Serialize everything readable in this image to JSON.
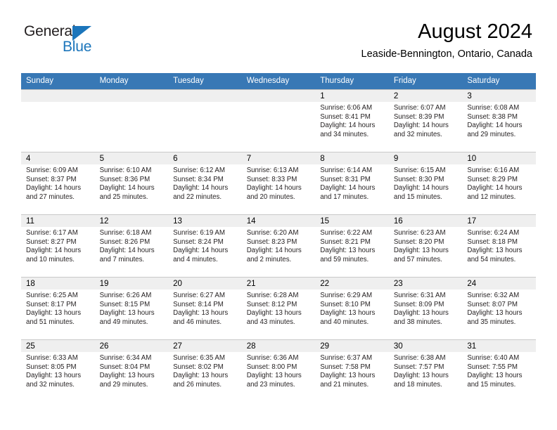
{
  "brand": {
    "word_one": "General",
    "word_two": "Blue",
    "logo_icon": "triangle-flag-icon"
  },
  "header": {
    "title": "August 2024",
    "subtitle": "Leaside-Bennington, Ontario, Canada"
  },
  "calendar": {
    "accent_color": "#3878b5",
    "daynum_bg": "#efefef",
    "weekday_headers": [
      "Sunday",
      "Monday",
      "Tuesday",
      "Wednesday",
      "Thursday",
      "Friday",
      "Saturday"
    ],
    "weeks": [
      [
        {
          "day": "",
          "sunrise": "",
          "sunset": "",
          "daylight_line1": "",
          "daylight_line2": ""
        },
        {
          "day": "",
          "sunrise": "",
          "sunset": "",
          "daylight_line1": "",
          "daylight_line2": ""
        },
        {
          "day": "",
          "sunrise": "",
          "sunset": "",
          "daylight_line1": "",
          "daylight_line2": ""
        },
        {
          "day": "",
          "sunrise": "",
          "sunset": "",
          "daylight_line1": "",
          "daylight_line2": ""
        },
        {
          "day": "1",
          "sunrise": "Sunrise: 6:06 AM",
          "sunset": "Sunset: 8:41 PM",
          "daylight_line1": "Daylight: 14 hours",
          "daylight_line2": "and 34 minutes."
        },
        {
          "day": "2",
          "sunrise": "Sunrise: 6:07 AM",
          "sunset": "Sunset: 8:39 PM",
          "daylight_line1": "Daylight: 14 hours",
          "daylight_line2": "and 32 minutes."
        },
        {
          "day": "3",
          "sunrise": "Sunrise: 6:08 AM",
          "sunset": "Sunset: 8:38 PM",
          "daylight_line1": "Daylight: 14 hours",
          "daylight_line2": "and 29 minutes."
        }
      ],
      [
        {
          "day": "4",
          "sunrise": "Sunrise: 6:09 AM",
          "sunset": "Sunset: 8:37 PM",
          "daylight_line1": "Daylight: 14 hours",
          "daylight_line2": "and 27 minutes."
        },
        {
          "day": "5",
          "sunrise": "Sunrise: 6:10 AM",
          "sunset": "Sunset: 8:36 PM",
          "daylight_line1": "Daylight: 14 hours",
          "daylight_line2": "and 25 minutes."
        },
        {
          "day": "6",
          "sunrise": "Sunrise: 6:12 AM",
          "sunset": "Sunset: 8:34 PM",
          "daylight_line1": "Daylight: 14 hours",
          "daylight_line2": "and 22 minutes."
        },
        {
          "day": "7",
          "sunrise": "Sunrise: 6:13 AM",
          "sunset": "Sunset: 8:33 PM",
          "daylight_line1": "Daylight: 14 hours",
          "daylight_line2": "and 20 minutes."
        },
        {
          "day": "8",
          "sunrise": "Sunrise: 6:14 AM",
          "sunset": "Sunset: 8:31 PM",
          "daylight_line1": "Daylight: 14 hours",
          "daylight_line2": "and 17 minutes."
        },
        {
          "day": "9",
          "sunrise": "Sunrise: 6:15 AM",
          "sunset": "Sunset: 8:30 PM",
          "daylight_line1": "Daylight: 14 hours",
          "daylight_line2": "and 15 minutes."
        },
        {
          "day": "10",
          "sunrise": "Sunrise: 6:16 AM",
          "sunset": "Sunset: 8:29 PM",
          "daylight_line1": "Daylight: 14 hours",
          "daylight_line2": "and 12 minutes."
        }
      ],
      [
        {
          "day": "11",
          "sunrise": "Sunrise: 6:17 AM",
          "sunset": "Sunset: 8:27 PM",
          "daylight_line1": "Daylight: 14 hours",
          "daylight_line2": "and 10 minutes."
        },
        {
          "day": "12",
          "sunrise": "Sunrise: 6:18 AM",
          "sunset": "Sunset: 8:26 PM",
          "daylight_line1": "Daylight: 14 hours",
          "daylight_line2": "and 7 minutes."
        },
        {
          "day": "13",
          "sunrise": "Sunrise: 6:19 AM",
          "sunset": "Sunset: 8:24 PM",
          "daylight_line1": "Daylight: 14 hours",
          "daylight_line2": "and 4 minutes."
        },
        {
          "day": "14",
          "sunrise": "Sunrise: 6:20 AM",
          "sunset": "Sunset: 8:23 PM",
          "daylight_line1": "Daylight: 14 hours",
          "daylight_line2": "and 2 minutes."
        },
        {
          "day": "15",
          "sunrise": "Sunrise: 6:22 AM",
          "sunset": "Sunset: 8:21 PM",
          "daylight_line1": "Daylight: 13 hours",
          "daylight_line2": "and 59 minutes."
        },
        {
          "day": "16",
          "sunrise": "Sunrise: 6:23 AM",
          "sunset": "Sunset: 8:20 PM",
          "daylight_line1": "Daylight: 13 hours",
          "daylight_line2": "and 57 minutes."
        },
        {
          "day": "17",
          "sunrise": "Sunrise: 6:24 AM",
          "sunset": "Sunset: 8:18 PM",
          "daylight_line1": "Daylight: 13 hours",
          "daylight_line2": "and 54 minutes."
        }
      ],
      [
        {
          "day": "18",
          "sunrise": "Sunrise: 6:25 AM",
          "sunset": "Sunset: 8:17 PM",
          "daylight_line1": "Daylight: 13 hours",
          "daylight_line2": "and 51 minutes."
        },
        {
          "day": "19",
          "sunrise": "Sunrise: 6:26 AM",
          "sunset": "Sunset: 8:15 PM",
          "daylight_line1": "Daylight: 13 hours",
          "daylight_line2": "and 49 minutes."
        },
        {
          "day": "20",
          "sunrise": "Sunrise: 6:27 AM",
          "sunset": "Sunset: 8:14 PM",
          "daylight_line1": "Daylight: 13 hours",
          "daylight_line2": "and 46 minutes."
        },
        {
          "day": "21",
          "sunrise": "Sunrise: 6:28 AM",
          "sunset": "Sunset: 8:12 PM",
          "daylight_line1": "Daylight: 13 hours",
          "daylight_line2": "and 43 minutes."
        },
        {
          "day": "22",
          "sunrise": "Sunrise: 6:29 AM",
          "sunset": "Sunset: 8:10 PM",
          "daylight_line1": "Daylight: 13 hours",
          "daylight_line2": "and 40 minutes."
        },
        {
          "day": "23",
          "sunrise": "Sunrise: 6:31 AM",
          "sunset": "Sunset: 8:09 PM",
          "daylight_line1": "Daylight: 13 hours",
          "daylight_line2": "and 38 minutes."
        },
        {
          "day": "24",
          "sunrise": "Sunrise: 6:32 AM",
          "sunset": "Sunset: 8:07 PM",
          "daylight_line1": "Daylight: 13 hours",
          "daylight_line2": "and 35 minutes."
        }
      ],
      [
        {
          "day": "25",
          "sunrise": "Sunrise: 6:33 AM",
          "sunset": "Sunset: 8:05 PM",
          "daylight_line1": "Daylight: 13 hours",
          "daylight_line2": "and 32 minutes."
        },
        {
          "day": "26",
          "sunrise": "Sunrise: 6:34 AM",
          "sunset": "Sunset: 8:04 PM",
          "daylight_line1": "Daylight: 13 hours",
          "daylight_line2": "and 29 minutes."
        },
        {
          "day": "27",
          "sunrise": "Sunrise: 6:35 AM",
          "sunset": "Sunset: 8:02 PM",
          "daylight_line1": "Daylight: 13 hours",
          "daylight_line2": "and 26 minutes."
        },
        {
          "day": "28",
          "sunrise": "Sunrise: 6:36 AM",
          "sunset": "Sunset: 8:00 PM",
          "daylight_line1": "Daylight: 13 hours",
          "daylight_line2": "and 23 minutes."
        },
        {
          "day": "29",
          "sunrise": "Sunrise: 6:37 AM",
          "sunset": "Sunset: 7:58 PM",
          "daylight_line1": "Daylight: 13 hours",
          "daylight_line2": "and 21 minutes."
        },
        {
          "day": "30",
          "sunrise": "Sunrise: 6:38 AM",
          "sunset": "Sunset: 7:57 PM",
          "daylight_line1": "Daylight: 13 hours",
          "daylight_line2": "and 18 minutes."
        },
        {
          "day": "31",
          "sunrise": "Sunrise: 6:40 AM",
          "sunset": "Sunset: 7:55 PM",
          "daylight_line1": "Daylight: 13 hours",
          "daylight_line2": "and 15 minutes."
        }
      ]
    ]
  }
}
